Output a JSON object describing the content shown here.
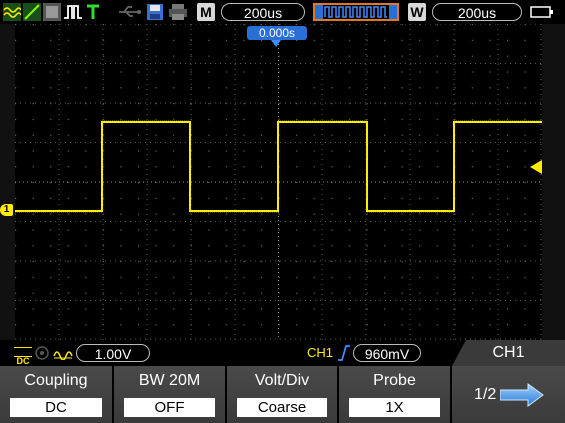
{
  "topbar": {
    "mode_badge": "M",
    "timebase": "200us",
    "window_badge": "W",
    "window_timebase": "200us"
  },
  "waveform": {
    "trigger_position": "0.000s",
    "channel_marker": "1"
  },
  "status": {
    "coupling_icon": "DC",
    "volts_div": "1.00V",
    "trigger_source": "CH1",
    "trigger_level": "960mV",
    "menu_title": "CH1"
  },
  "softkeys": [
    {
      "title": "Coupling",
      "value": "DC"
    },
    {
      "title": "BW 20M",
      "value": "OFF"
    },
    {
      "title": "Volt/Div",
      "value": "Coarse"
    },
    {
      "title": "Probe",
      "value": "1X"
    },
    {
      "title": "1/2"
    }
  ],
  "colors": {
    "trace": "#ffee00",
    "grid": "#7a7a7a",
    "accent": "#2a6fd6",
    "status_bg": "#000000"
  }
}
